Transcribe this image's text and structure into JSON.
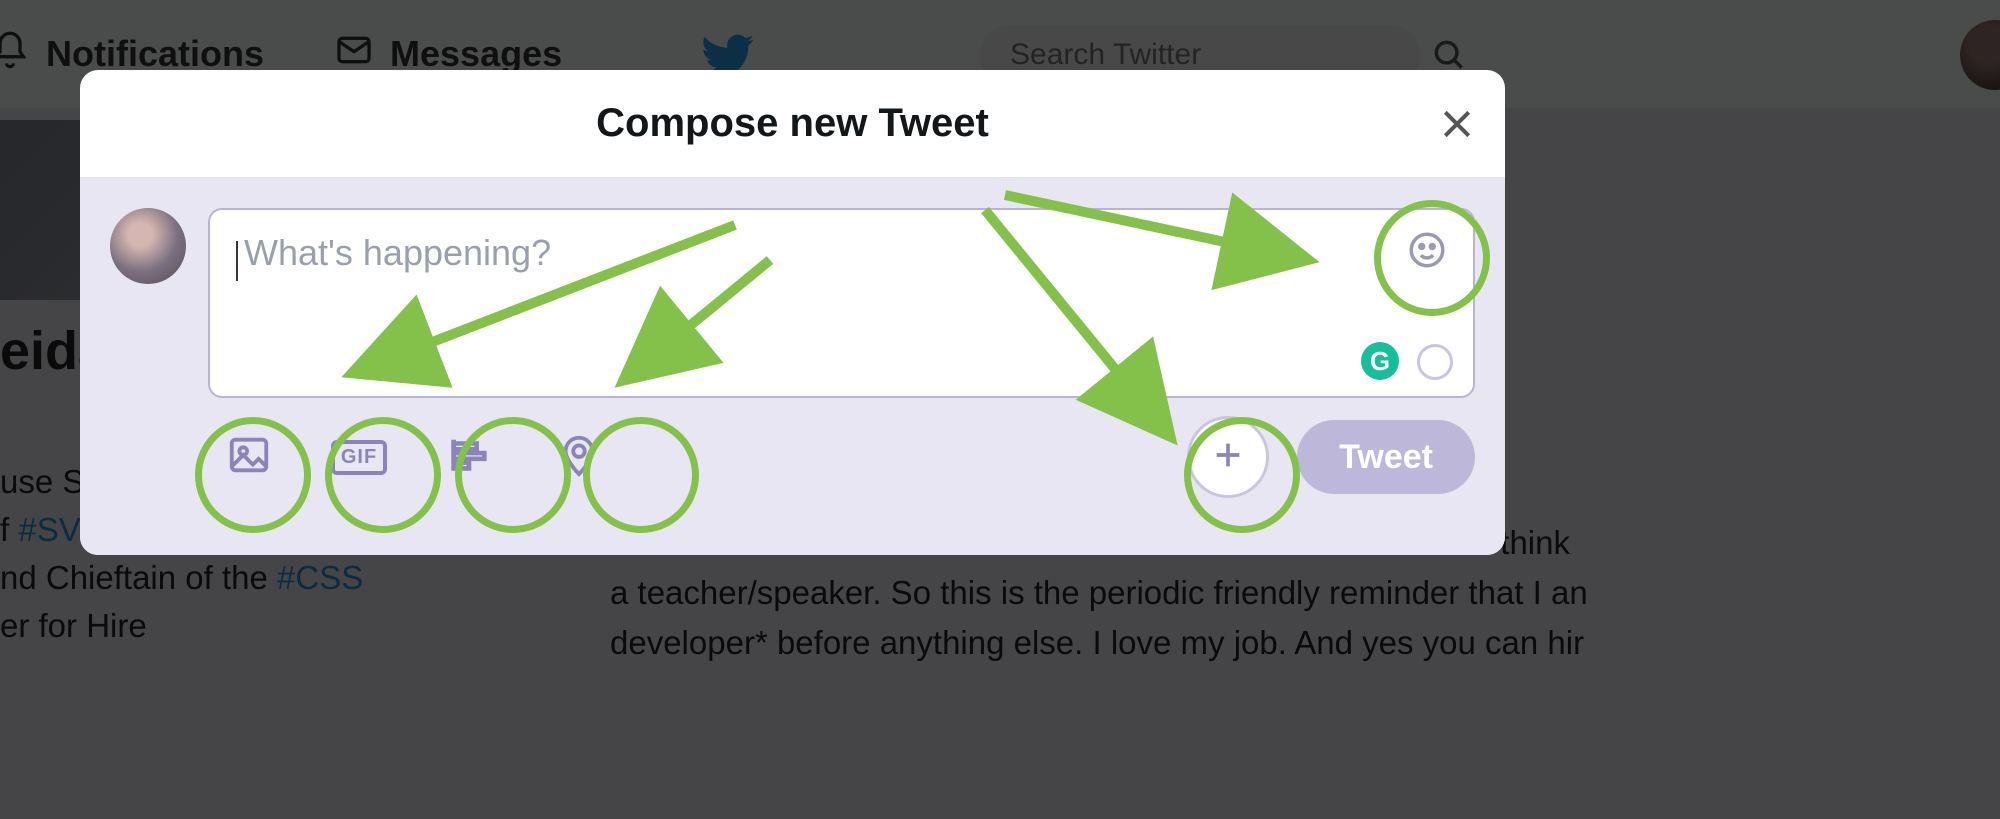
{
  "nav": {
    "notifications_label": "Notifications",
    "messages_label": "Messages",
    "search_placeholder": "Search Twitter"
  },
  "background": {
    "name_fragment": "eida",
    "bio_line1_prefix": "use S",
    "bio_line2_prefix": "f ",
    "bio_line2_link": "#SV",
    "bio_line3_prefix": "nd Chieftain of the ",
    "bio_line3_link": "#CSS",
    "bio_line4": "er for Hire",
    "para_line1": "think",
    "para_line2": "a teacher/speaker. So this is the periodic friendly reminder that I an",
    "para_line3": "developer* before anything else. I love my job. And yes you can hir"
  },
  "modal": {
    "title": "Compose new Tweet",
    "placeholder": "What's happening?",
    "gif_label": "GIF",
    "grammarly_label": "G",
    "tweet_button": "Tweet"
  }
}
